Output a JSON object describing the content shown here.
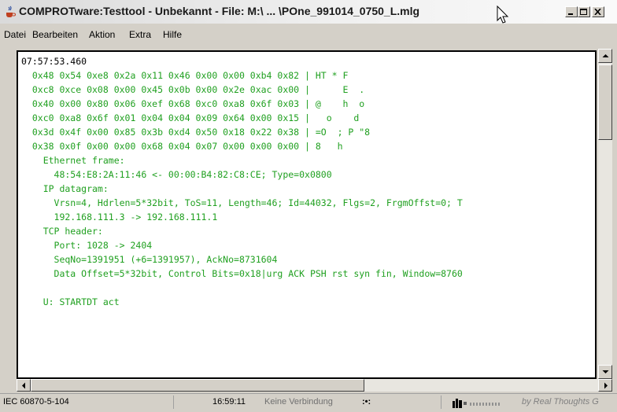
{
  "window": {
    "title": "COMPROTware:Testtool - Unbekannt - File: M:\\ ... \\POne_991014_0750_L.mlg"
  },
  "menu": [
    "Datei",
    "Bearbeiten",
    "Aktion",
    "Extra",
    "Hilfe"
  ],
  "log": {
    "timestamp": "07:57:53.460",
    "lines": [
      "  0x48 0x54 0xe8 0x2a 0x11 0x46 0x00 0x00 0xb4 0x82 | HT * F",
      "  0xc8 0xce 0x08 0x00 0x45 0x0b 0x00 0x2e 0xac 0x00 |      E  .",
      "  0x40 0x00 0x80 0x06 0xef 0x68 0xc0 0xa8 0x6f 0x03 | @    h  o",
      "  0xc0 0xa8 0x6f 0x01 0x04 0x04 0x09 0x64 0x00 0x15 |   o    d",
      "  0x3d 0x4f 0x00 0x85 0x3b 0xd4 0x50 0x18 0x22 0x38 | =O  ; P \"8",
      "  0x38 0x0f 0x00 0x00 0x68 0x04 0x07 0x00 0x00 0x00 | 8   h",
      "    Ethernet frame:",
      "      48:54:E8:2A:11:46 <- 00:00:B4:82:C8:CE; Type=0x0800",
      "    IP datagram:",
      "      Vrsn=4, Hdrlen=5*32bit, ToS=11, Length=46; Id=44032, Flgs=2, FrgmOffst=0; T",
      "      192.168.111.3 -> 192.168.111.1",
      "    TCP header:",
      "      Port: 1028 -> 2404",
      "      SeqNo=1391951 (+6=1391957), AckNo=8731604",
      "      Data Offset=5*32bit, Control Bits=0x18|urg ACK PSH rst syn fin, Window=8760",
      "",
      "    U: STARTDT act"
    ]
  },
  "status": {
    "protocol": "IEC 60870-5-104",
    "time": "16:59:11",
    "connection": "Keine Verbindung",
    "dots": ":•:",
    "brand": "by Real Thoughts G"
  },
  "colors": {
    "log_text": "#20a020",
    "timestamp": "#000000",
    "background": "#d4d0c8"
  }
}
